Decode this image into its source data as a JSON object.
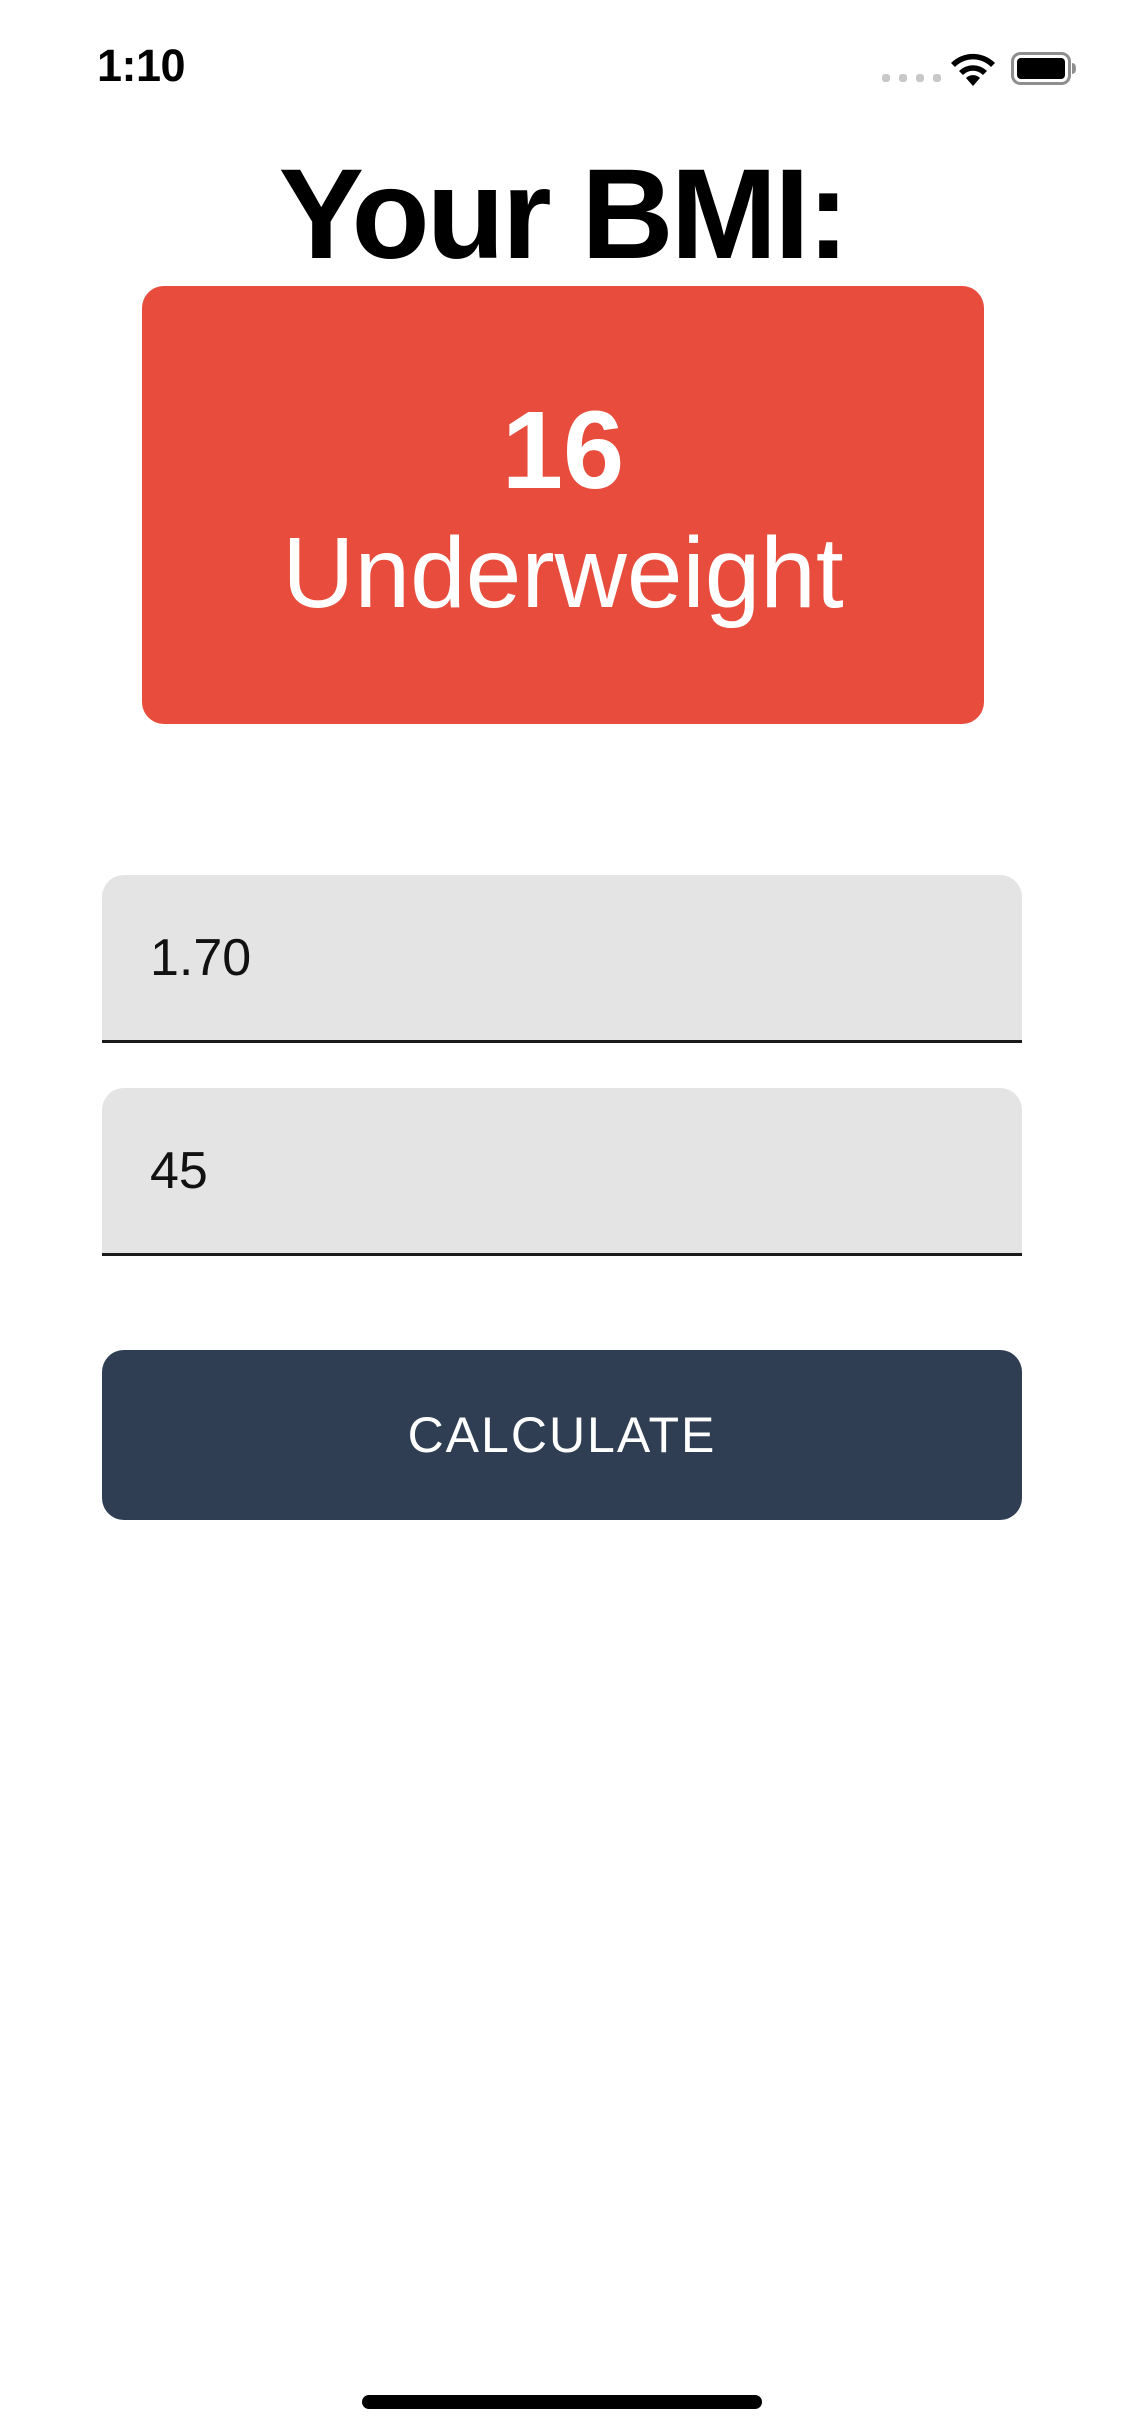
{
  "status_bar": {
    "time": "1:10",
    "icons": [
      "cellular-signal-icon",
      "wifi-icon",
      "battery-icon"
    ]
  },
  "header": {
    "title": "Your BMI:"
  },
  "result": {
    "value": "16",
    "category": "Underweight",
    "color": "#e74c3c"
  },
  "form": {
    "height_value": "1.70",
    "weight_value": "45",
    "calculate_label": "CALCULATE",
    "button_color": "#2f3e52",
    "field_color": "#e4e4e4"
  }
}
